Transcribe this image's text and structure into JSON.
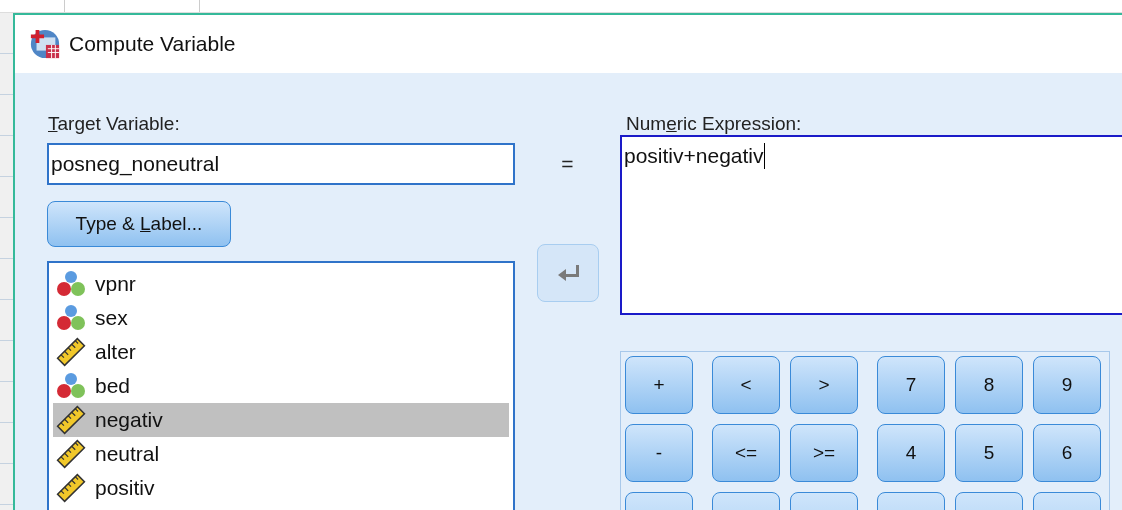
{
  "window": {
    "title": "Compute Variable"
  },
  "target_variable": {
    "label": {
      "key": "T",
      "after": "arget Variable:"
    },
    "value": "posneg_noneutral"
  },
  "equals_sign": "=",
  "type_label_button": {
    "before": "Type & ",
    "key": "L",
    "after": "abel..."
  },
  "variables": [
    {
      "name": "vpnr",
      "kind": "nominal",
      "selected": false
    },
    {
      "name": "sex",
      "kind": "nominal",
      "selected": false
    },
    {
      "name": "alter",
      "kind": "scale",
      "selected": false
    },
    {
      "name": "bed",
      "kind": "nominal",
      "selected": false
    },
    {
      "name": "negativ",
      "kind": "scale",
      "selected": true
    },
    {
      "name": "neutral",
      "kind": "scale",
      "selected": false
    },
    {
      "name": "positiv",
      "kind": "scale",
      "selected": false
    }
  ],
  "numeric_expression": {
    "label": {
      "before": "Num",
      "key": "e",
      "after": "ric Expression:"
    },
    "value": "positiv+negativ"
  },
  "keypad": [
    [
      {
        "label": "+"
      },
      {
        "label": "<"
      },
      {
        "label": ">"
      },
      {
        "label": "7"
      },
      {
        "label": "8"
      },
      {
        "label": "9"
      }
    ],
    [
      {
        "label": "-"
      },
      {
        "label": "<="
      },
      {
        "label": ">="
      },
      {
        "label": "4"
      },
      {
        "label": "5"
      },
      {
        "label": "6"
      }
    ],
    [
      {
        "kind": "cut"
      },
      {
        "kind": "cut"
      },
      {
        "kind": "cut"
      },
      {
        "kind": "cut"
      },
      {
        "kind": "cut"
      },
      {
        "kind": "cut"
      }
    ]
  ]
}
